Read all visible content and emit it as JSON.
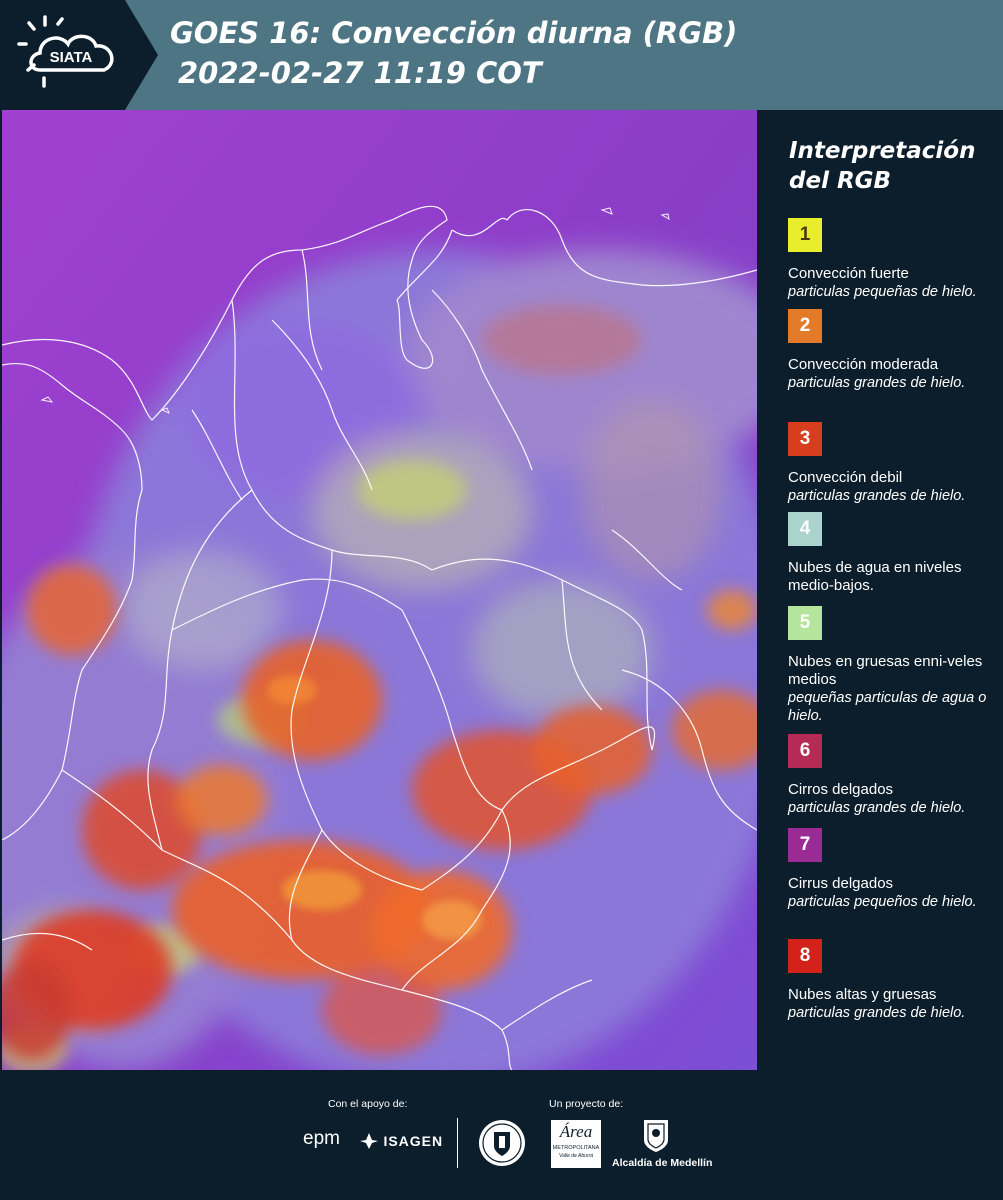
{
  "header": {
    "title_line1": "GOES 16: Convección diurna (RGB)",
    "title_line2": "2022-02-27 11:19 COT",
    "logo_text": "SIATA",
    "logo_icon": "sun-cloud-icon"
  },
  "map": {
    "description_icon": "satellite-rgb-map",
    "colors": {
      "ocean_magenta": "#8a3ccc",
      "land_violet": "#8a78e0",
      "convection_orange": "#e8612a",
      "low_cloud_green": "#b6d89a",
      "border_white": "#ffffff"
    }
  },
  "legend": {
    "title_line1": "Interpretación",
    "title_line2": "del RGB",
    "items": [
      {
        "number": "1",
        "color": "#e8ee2c",
        "text_color": "#4a3a0a",
        "title": "Convección fuerte",
        "desc": "particulas pequeñas de hielo."
      },
      {
        "number": "2",
        "color": "#e27a2a",
        "text_color": "#ffffff",
        "title": "Convección moderada",
        "desc": "particulas grandes de hielo."
      },
      {
        "number": "3",
        "color": "#d63e1e",
        "text_color": "#ffffff",
        "title": "Convección debil",
        "desc": "particulas grandes de hielo."
      },
      {
        "number": "4",
        "color": "#a9d3cc",
        "text_color": "#ffffff",
        "title": "Nubes de agua en niveles medio-bajos.",
        "desc": ""
      },
      {
        "number": "5",
        "color": "#b5e49c",
        "text_color": "#ffffff",
        "title": "Nubes en gruesas enni-veles medios",
        "desc": "pequeñas particulas de agua o hielo."
      },
      {
        "number": "6",
        "color": "#b52b55",
        "text_color": "#ffffff",
        "title": "Cirros delgados",
        "desc": "particulas grandes de hielo."
      },
      {
        "number": "7",
        "color": "#9a2b94",
        "text_color": "#ffffff",
        "title": "Cirrus delgados",
        "desc": "particulas pequeños de hielo."
      },
      {
        "number": "8",
        "color": "#d2221a",
        "text_color": "#ffffff",
        "title": "Nubes altas y gruesas",
        "desc": "particulas grandes de hielo."
      }
    ]
  },
  "footer": {
    "support_caption": "Con el apoyo de:",
    "project_caption": "Un proyecto de:",
    "epm_text": "epm",
    "isagen_text": "ISAGEN",
    "area_text": "Área",
    "area_sub1": "METROPOLITANA",
    "area_sub2": "Valle de Aburrá",
    "alcaldia_text": "Alcaldía de Medellín"
  }
}
